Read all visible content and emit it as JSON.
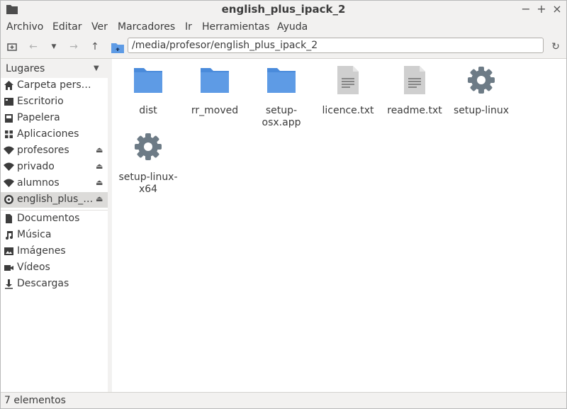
{
  "window": {
    "title": "english_plus_ipack_2"
  },
  "menubar": {
    "items": [
      "Archivo",
      "Editar",
      "Ver",
      "Marcadores",
      "Ir",
      "Herramientas",
      "Ayuda"
    ]
  },
  "location": {
    "path": "/media/profesor/english_plus_ipack_2"
  },
  "sidebar": {
    "header": "Lugares",
    "items": [
      {
        "label": "Carpeta pers…",
        "icon": "home-icon"
      },
      {
        "label": "Escritorio",
        "icon": "desktop-icon"
      },
      {
        "label": "Papelera",
        "icon": "trash-icon"
      },
      {
        "label": "Aplicaciones",
        "icon": "apps-icon"
      },
      {
        "label": "profesores",
        "icon": "network-icon"
      },
      {
        "label": "privado",
        "icon": "network-icon"
      },
      {
        "label": "alumnos",
        "icon": "network-icon"
      },
      {
        "label": "english_plus_…",
        "icon": "disc-icon"
      },
      {
        "label": "Documentos",
        "icon": "documents-icon"
      },
      {
        "label": "Música",
        "icon": "music-icon"
      },
      {
        "label": "Imágenes",
        "icon": "pictures-icon"
      },
      {
        "label": "Vídeos",
        "icon": "videos-icon"
      },
      {
        "label": "Descargas",
        "icon": "downloads-icon"
      }
    ]
  },
  "files": [
    {
      "name": "dist",
      "icon": "folder-icon"
    },
    {
      "name": "rr_moved",
      "icon": "folder-icon"
    },
    {
      "name": "setup-osx.app",
      "icon": "folder-icon"
    },
    {
      "name": "licence.txt",
      "icon": "text-file-icon"
    },
    {
      "name": "readme.txt",
      "icon": "text-file-icon"
    },
    {
      "name": "setup-linux",
      "icon": "gear-icon"
    },
    {
      "name": "setup-linux-x64",
      "icon": "gear-icon"
    }
  ],
  "status": {
    "text": "7 elementos"
  },
  "colors": {
    "folder": "#5e9be5",
    "gear": "#6d7b86",
    "textfile": "#cfcfcf",
    "background": "#f2f1f0"
  }
}
